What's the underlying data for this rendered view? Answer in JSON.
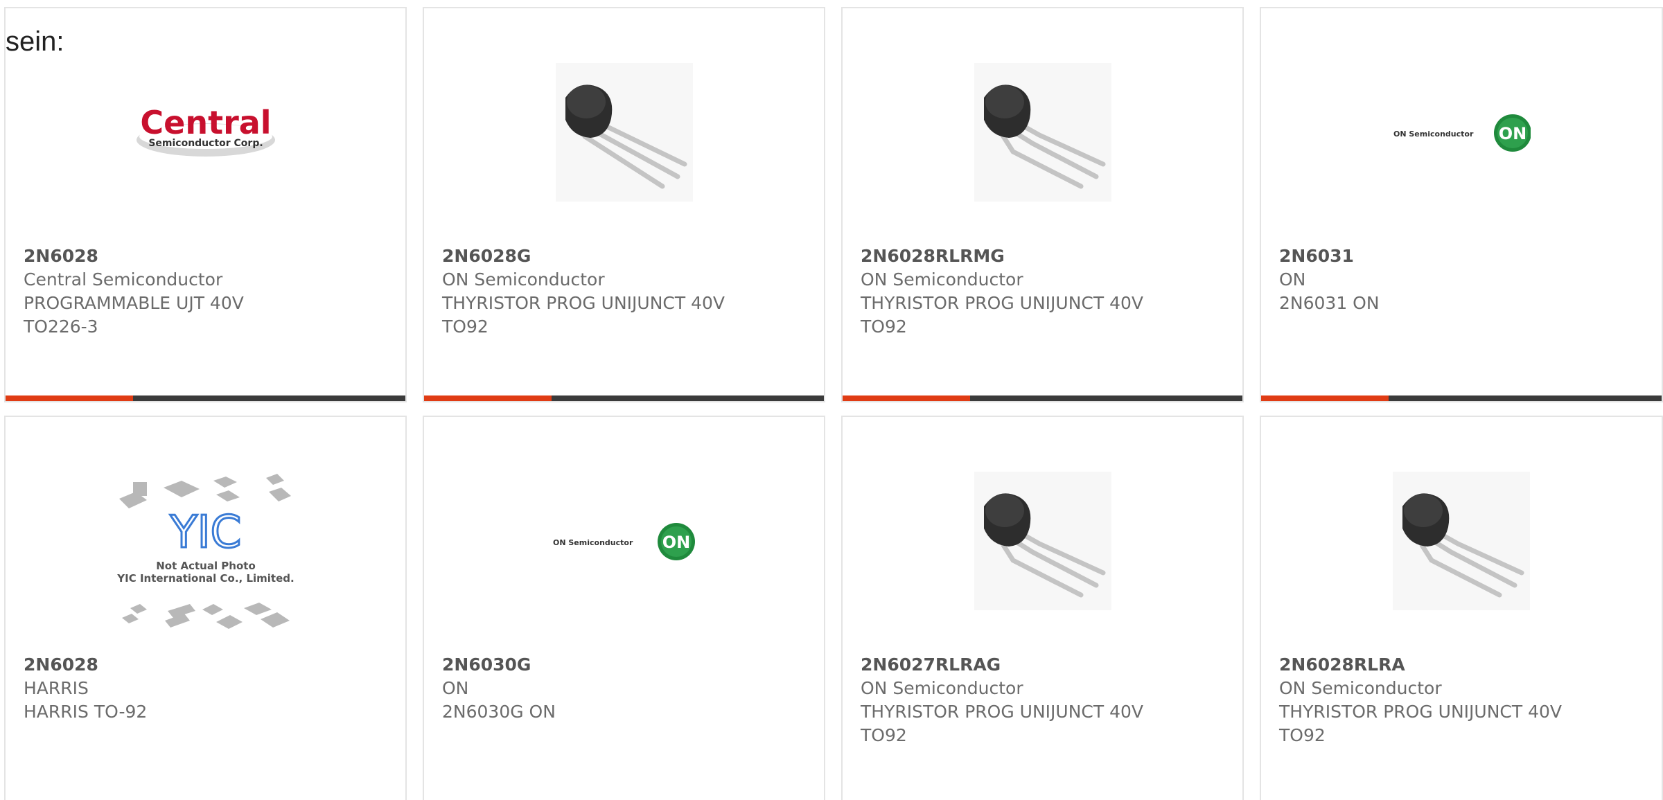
{
  "caption": "sein:",
  "products": [
    {
      "part_number": "2N6028",
      "manufacturer": "Central Semiconductor",
      "line2": "PROGRAMMABLE UJT 40V",
      "line3": "TO226-3",
      "image": "central-semiconductor-logo",
      "logo_text": "Central",
      "logo_sub": "Semiconductor Corp."
    },
    {
      "part_number": "2N6028G",
      "manufacturer": "ON Semiconductor",
      "line2": "THYRISTOR PROG UNIJUNCT 40V",
      "line3": "TO92",
      "image": "to92-transistor-photo"
    },
    {
      "part_number": "2N6028RLRMG",
      "manufacturer": "ON Semiconductor",
      "line2": "THYRISTOR PROG UNIJUNCT 40V",
      "line3": "TO92",
      "image": "to92-transistor-photo"
    },
    {
      "part_number": "2N6031",
      "manufacturer": "ON",
      "line2": "2N6031 ON",
      "line3": "",
      "image": "on-semiconductor-logo",
      "logo_text": "ON Semiconductor",
      "logo_badge": "ON"
    },
    {
      "part_number": "2N6028",
      "manufacturer": "HARRIS",
      "line2": "HARRIS TO-92",
      "line3": "",
      "image": "yic-not-actual-photo",
      "logo_line1": "Not Actual Photo",
      "logo_line2": "YIC International Co., Limited."
    },
    {
      "part_number": "2N6030G",
      "manufacturer": "ON",
      "line2": "2N6030G ON",
      "line3": "",
      "image": "on-semiconductor-logo",
      "logo_text": "ON Semiconductor",
      "logo_badge": "ON"
    },
    {
      "part_number": "2N6027RLRAG",
      "manufacturer": "ON Semiconductor",
      "line2": "THYRISTOR PROG UNIJUNCT 40V",
      "line3": "TO92",
      "image": "to92-transistor-photo"
    },
    {
      "part_number": "2N6028RLRA",
      "manufacturer": "ON Semiconductor",
      "line2": "THYRISTOR PROG UNIJUNCT 40V",
      "line3": "TO92",
      "image": "to92-transistor-photo"
    }
  ],
  "colors": {
    "accent": "#e03c14",
    "bar": "#3b3b3b",
    "text": "#6b6b6b",
    "border": "#e4e4e4"
  }
}
